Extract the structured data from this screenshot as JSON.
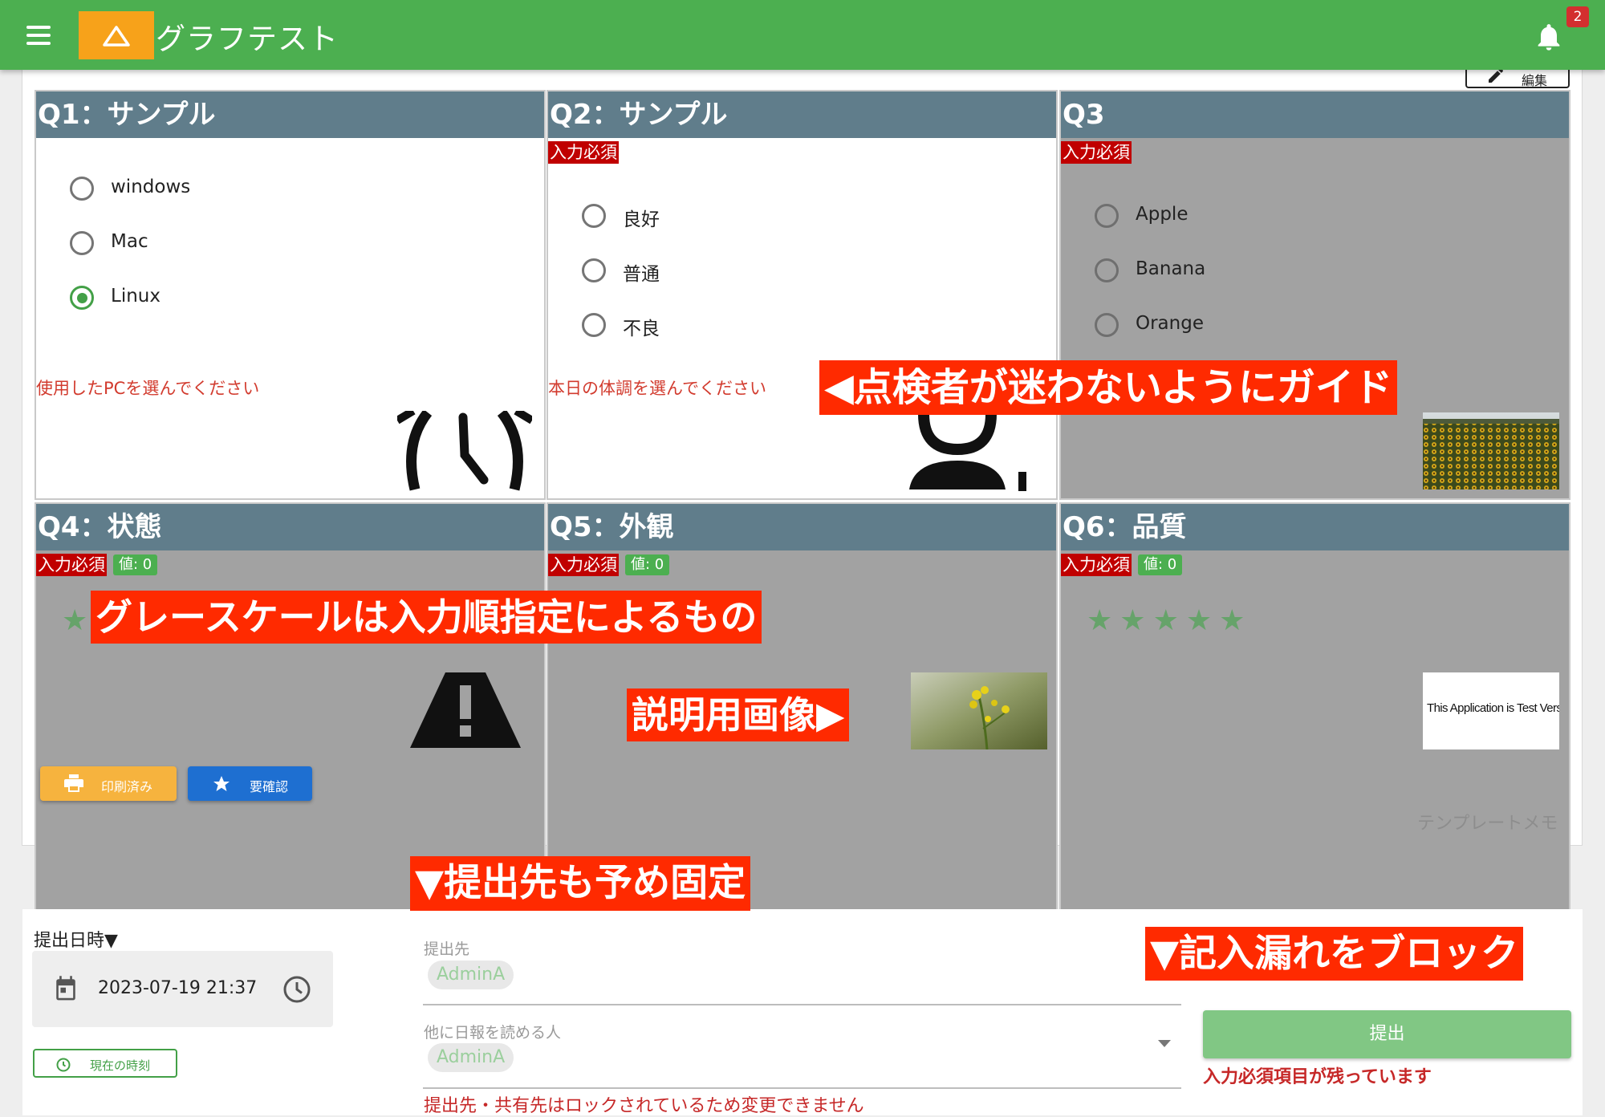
{
  "header": {
    "title": "グラフテスト",
    "notification_count": "2",
    "brand_color": "#4caf50"
  },
  "card": {
    "edit_label": "編集",
    "questions": [
      {
        "title": "Q1：サンプル",
        "options": [
          {
            "label": "windows",
            "selected": false
          },
          {
            "label": "Mac",
            "selected": false
          },
          {
            "label": "Linux",
            "selected": true
          }
        ],
        "guide": "使用したPCを選んでください",
        "image": "clock-icon"
      },
      {
        "title": "Q2：サンプル",
        "required": "入力必須",
        "options": [
          {
            "label": "良好",
            "selected": false
          },
          {
            "label": "普通",
            "selected": false
          },
          {
            "label": "不良",
            "selected": false
          }
        ],
        "guide": "本日の体調を選んでください",
        "image": "person-icon"
      },
      {
        "title": "Q3",
        "required": "入力必須",
        "options": [
          {
            "label": "Apple",
            "selected": false
          },
          {
            "label": "Banana",
            "selected": false
          },
          {
            "label": "Orange",
            "selected": false
          }
        ],
        "image": "sunflower-photo"
      },
      {
        "title": "Q4：状態",
        "required": "入力必須",
        "value": "値: 0",
        "image": "warning-icon"
      },
      {
        "title": "Q5：外観",
        "required": "入力必須",
        "value": "値: 0",
        "image": "flower-photo"
      },
      {
        "title": "Q6：品質",
        "required": "入力必須",
        "value": "値: 0",
        "rating": 0,
        "rating_max": 5,
        "image_text": "This Application is Test Version"
      }
    ],
    "print_label": "印刷済み",
    "confirm_label": "要確認",
    "memo": "テンプレートメモ"
  },
  "footer": {
    "date_label": "提出日時▼",
    "datetime": "2023-07-19 21:37",
    "now_label": "現在の時刻",
    "recipient_label": "提出先",
    "recipient": "AdminA",
    "readers_label": "他に日報を読める人",
    "reader": "AdminA",
    "lock_message": "提出先・共有先はロックされているため変更できません",
    "submit_label": "提出",
    "submit_warning": "入力必須項目が残っています"
  },
  "callouts": {
    "guide": "◀点検者が迷わないようにガイド",
    "grayscale": "グレースケールは入力順指定によるもの",
    "explain_image": "説明用画像▶",
    "fixed_recipient": "▼提出先も予め固定",
    "block_missing": "▼記入漏れをブロック"
  }
}
